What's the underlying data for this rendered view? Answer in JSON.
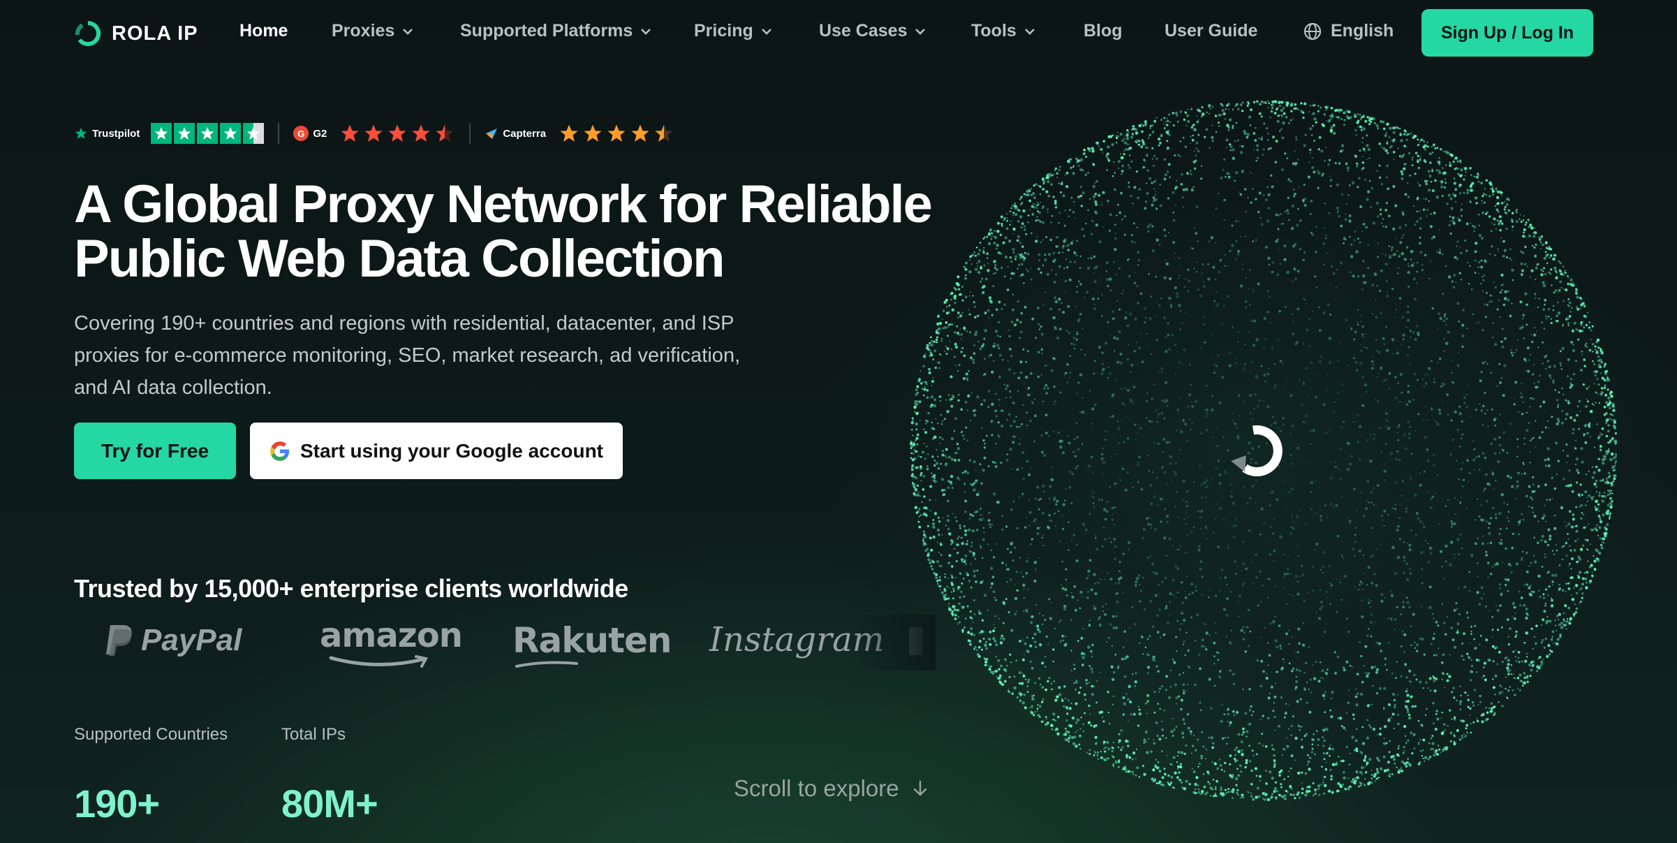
{
  "nav": {
    "logo_text": "ROLA IP",
    "home": "Home",
    "proxies": "Proxies",
    "supported_platforms": "Supported Platforms",
    "pricing": "Pricing",
    "use_cases": "Use Cases",
    "tools": "Tools",
    "blog": "Blog",
    "user_guide": "User Guide",
    "language": "English",
    "signup": "Sign Up / Log In"
  },
  "ratings": {
    "trustpilot": "Trustpilot",
    "g2": "G2",
    "g2_badge": "G",
    "capterra": "Capterra"
  },
  "hero": {
    "title_line1": "A Global Proxy Network for Reliable",
    "title_line2": "Public Web Data Collection",
    "subtitle": "Covering 190+ countries and regions with residential, datacenter, and ISP proxies for e-commerce monitoring, SEO, market research, ad verification, and AI data collection.",
    "try_free": "Try for Free",
    "google_button": "Start using your Google account"
  },
  "trusted": {
    "heading": "Trusted by 15,000+ enterprise clients worldwide",
    "logos": [
      "PayPal",
      "amazon",
      "Rakuten",
      "Instagram"
    ]
  },
  "stats": [
    {
      "label": "Supported Countries",
      "value": "190+"
    },
    {
      "label": "Total IPs",
      "value": "80M+"
    }
  ],
  "scroll_hint": "Scroll to explore",
  "colors": {
    "accent": "#25d7a2",
    "background": "#0b1515",
    "stat_value": "#7ff2cc",
    "trustpilot_green": "#00b67a",
    "star_orange": "#ff7a1a"
  },
  "icons": {
    "logo": "rola-ring-icon",
    "language": "globe-icon",
    "dropdown": "chevron-down-icon",
    "google": "google-g-icon",
    "scroll": "arrow-down-icon"
  }
}
